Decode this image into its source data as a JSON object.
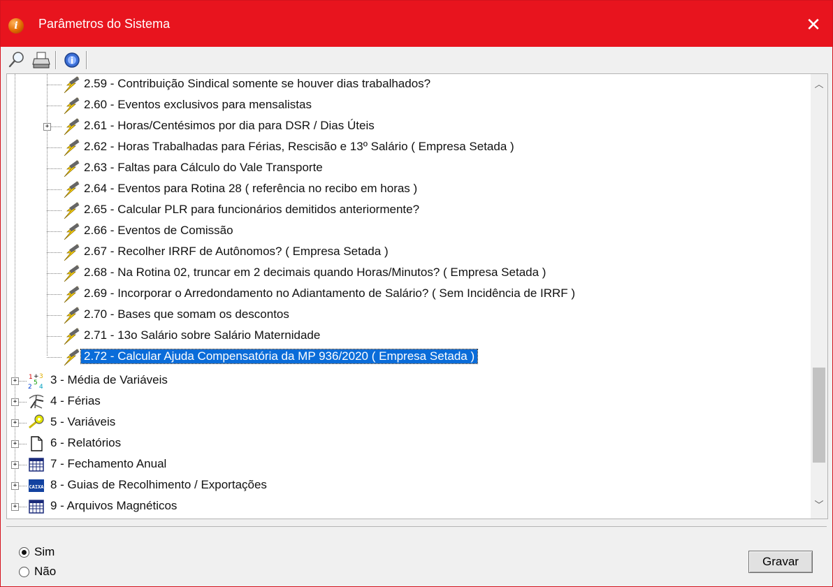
{
  "window": {
    "title": "Parâmetros do Sistema",
    "close_glyph": "✕",
    "accent_color": "#e8141e",
    "selection_color": "#0a6cd9"
  },
  "toolbar": {
    "buttons": [
      {
        "icon": "search-icon"
      },
      {
        "icon": "printer-icon"
      },
      {
        "icon": "info-icon"
      }
    ]
  },
  "tree": {
    "items": [
      {
        "label": "2.59 - Contribuição Sindical somente se houver dias trabalhados?",
        "icon": "pencil-lightning-icon"
      },
      {
        "label": "2.60 - Eventos exclusivos para mensalistas",
        "icon": "pencil-lightning-icon"
      },
      {
        "label": "2.61 - Horas/Centésimos por dia para DSR / Dias Úteis",
        "icon": "pencil-lightning-icon",
        "expander": "+"
      },
      {
        "label": "2.62 - Horas Trabalhadas para Férias, Rescisão e 13º Salário ( Empresa Setada )",
        "icon": "pencil-lightning-icon"
      },
      {
        "label": "2.63 - Faltas para Cálculo do Vale Transporte",
        "icon": "pencil-lightning-icon"
      },
      {
        "label": "2.64 - Eventos para Rotina 28 ( referência no recibo em horas )",
        "icon": "pencil-lightning-icon"
      },
      {
        "label": "2.65 - Calcular PLR para funcionários demitidos anteriormente?",
        "icon": "pencil-lightning-icon"
      },
      {
        "label": "2.66 - Eventos de Comissão",
        "icon": "pencil-lightning-icon"
      },
      {
        "label": "2.67 - Recolher IRRF de Autônomos? ( Empresa Setada )",
        "icon": "pencil-lightning-icon"
      },
      {
        "label": "2.68 - Na Rotina 02, truncar em 2 decimais quando Horas/Minutos? ( Empresa Setada )",
        "icon": "pencil-lightning-icon"
      },
      {
        "label": "2.69 - Incorporar o Arredondamento no Adiantamento de Salário? ( Sem Incidência de IRRF )",
        "icon": "pencil-lightning-icon"
      },
      {
        "label": "2.70 - Bases que somam os descontos",
        "icon": "pencil-lightning-icon"
      },
      {
        "label": "2.71 - 13o Salário sobre Salário Maternidade",
        "icon": "pencil-lightning-icon"
      },
      {
        "label": "2.72 - Calcular Ajuda Compensatória da MP 936/2020 ( Empresa Setada )",
        "icon": "pencil-lightning-icon",
        "selected": true
      }
    ],
    "groups": [
      {
        "label": "3 - Média de Variáveis",
        "icon": "numbers-icon",
        "expander": "+"
      },
      {
        "label": "4 - Férias",
        "icon": "beach-chair-icon",
        "expander": "+"
      },
      {
        "label": "5 - Variáveis",
        "icon": "key-icon",
        "expander": "+"
      },
      {
        "label": "6 - Relatórios",
        "icon": "document-icon",
        "expander": "+"
      },
      {
        "label": "7 - Fechamento Anual",
        "icon": "calendar-icon",
        "expander": "+"
      },
      {
        "label": "8 - Guias de Recolhimento / Exportações",
        "icon": "caixa-icon",
        "expander": "+"
      },
      {
        "label": "9 - Arquivos Magnéticos",
        "icon": "calendar-icon",
        "expander": "+"
      }
    ],
    "caixa_text": "CAIXA"
  },
  "options": {
    "sim_label": "Sim",
    "nao_label": "Não",
    "selected": "Sim"
  },
  "actions": {
    "gravar_label": "Gravar"
  }
}
